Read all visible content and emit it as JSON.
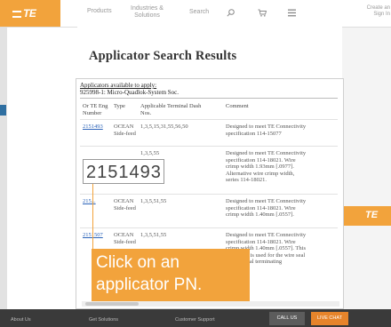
{
  "header": {
    "logo_text": "TE",
    "nav_products": "Products",
    "nav_industries_line1": "Industries &",
    "nav_industries_line2": "Solutions",
    "search_label": "Search",
    "account_line1": "Create an",
    "account_line2": "Sign In"
  },
  "page": {
    "title": "Applicator Search Results",
    "caption_line1": "Applicators available to apply:",
    "caption_line2": "925998-1: Micro-Quadlok-System Soc."
  },
  "table": {
    "headers": {
      "pn": "Or TE Eng Number",
      "type": "Type",
      "dash": "Applicable Terminal Dash Nos.",
      "comment": "Comment"
    },
    "rows": [
      {
        "pn": "2151493",
        "type": "OCEAN Side-feed",
        "dash": "1,3,5,15,31,55,56,50",
        "comment": "Designed to meet TE Connectivity specification 114-15077"
      },
      {
        "pn": "",
        "type": "",
        "dash": "1,3,5,55",
        "comment": "Designed to meet TE Connectivity specification 114-18021. Wire crimp width 1.93mm [.0977]. Alternative wire crimp width, series 114-18021."
      },
      {
        "pn": "215...",
        "type": "OCEAN Side-feed",
        "dash": "1,3,5,51,55",
        "comment": "Designed to meet TE Connectivity specification 114-18021. Wire crimp width 1.40mm [.0557]."
      },
      {
        "pn": "2151507",
        "type": "OCEAN Side-feed",
        "dash": "1,3,5,51,55",
        "comment": "Designed to meet TE Connectivity specification 114-18021. Wire crimp width 1.40mm [.0557]. This applicator is used for the wire seal stripper seal terminating applicator."
      }
    ]
  },
  "overlay": {
    "zoom_pn": "2151493",
    "callout_line1": "Click on an",
    "callout_line2": "applicator PN."
  },
  "footer": {
    "link1": "About Us",
    "link2": "Get Solutions",
    "link3": "Customer Support",
    "call_button": "CALL US",
    "chat_button": "LIVE CHAT"
  },
  "colors": {
    "brand_orange": "#f2a33c",
    "link_blue": "#2a62b8",
    "footer_dark": "#3a3a3a"
  }
}
